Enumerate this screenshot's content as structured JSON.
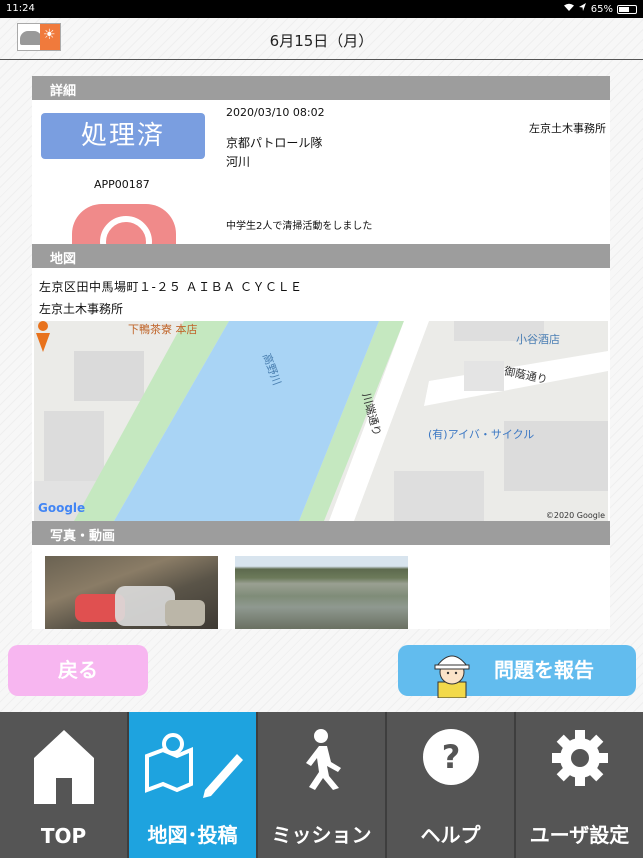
{
  "status_bar": {
    "time": "11:24",
    "battery": "65%",
    "battery_level": 0.65
  },
  "header": {
    "title": "6月15日（月）"
  },
  "detail": {
    "section_label": "詳細",
    "status": "処理済",
    "app_id": "APP00187",
    "datetime": "2020/03/10 08:02",
    "office": "左京土木事務所",
    "team": "京都パトロール隊",
    "category": "河川",
    "comment": "中学生2人で清掃活動をしました"
  },
  "map_section": {
    "section_label": "地図",
    "address": "左京区田中馬場町１-２５ ＡＩＢＡ ＣＹＣＬＥ",
    "office": "左京土木事務所",
    "labels": {
      "tea_shop": "下鴨茶寮 本店",
      "river": "高野川",
      "liquor_store": "小谷酒店",
      "road_goin": "御蔭通り",
      "road_kawabata": "川端通り",
      "cycle_shop": "(有)アイバ・サイクル",
      "google": "Google",
      "copyright": "©2020 Google"
    }
  },
  "media_section": {
    "section_label": "写真・動画"
  },
  "actions": {
    "back": "戻る",
    "report": "問題を報告"
  },
  "tabs": [
    {
      "label": "TOP",
      "icon": "home-icon"
    },
    {
      "label": "地図･投稿",
      "icon": "map-pencil-icon",
      "active": true
    },
    {
      "label": "ミッション",
      "icon": "walking-person-icon"
    },
    {
      "label": "ヘルプ",
      "icon": "question-icon"
    },
    {
      "label": "ユーザ設定",
      "icon": "gear-icon"
    }
  ],
  "colors": {
    "status_badge": "#7a9ee0",
    "back_button": "#f7b6f0",
    "report_button": "#62bcee",
    "tab_active": "#1ea3df",
    "tab_bar": "#555555",
    "section_header": "#9d9d9d"
  }
}
